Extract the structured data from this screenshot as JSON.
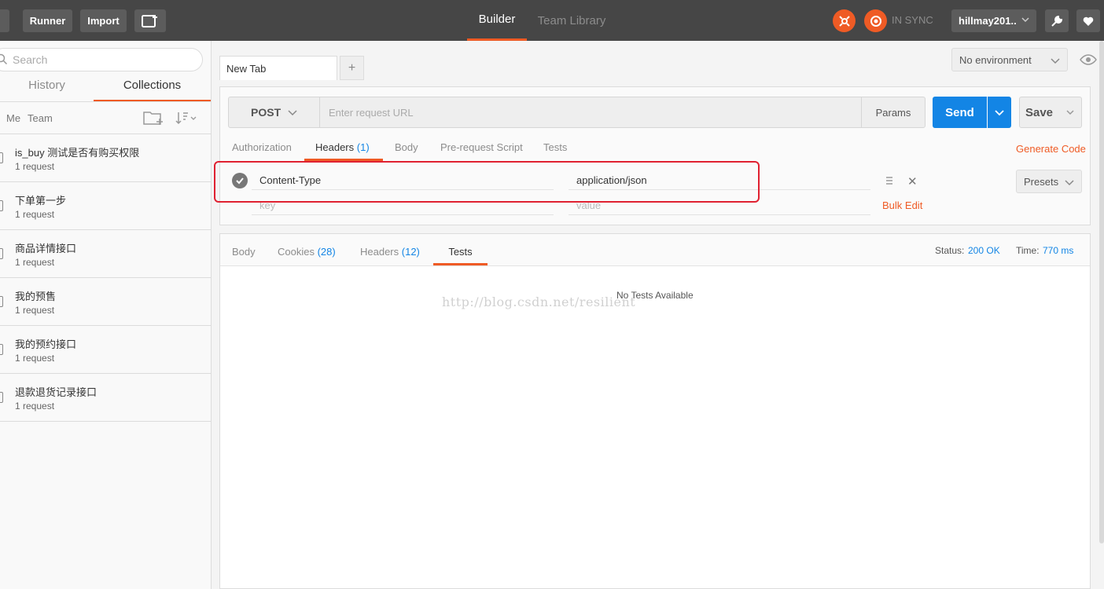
{
  "topbar": {
    "runner_label": "Runner",
    "import_label": "Import",
    "nav": {
      "builder": "Builder",
      "team_library": "Team Library"
    },
    "sync_status": "IN SYNC",
    "user": "hillmay201..",
    "accent": "#ef5b25"
  },
  "sidebar": {
    "search_placeholder": "Search",
    "tabs": {
      "history": "History",
      "collections": "Collections"
    },
    "filters": {
      "me": "Me",
      "team": "Team"
    },
    "collections": [
      {
        "name": "is_buy 测试是否有购买权限",
        "count": "1 request"
      },
      {
        "name": "下单第一步",
        "count": "1 request"
      },
      {
        "name": "商品详情接口",
        "count": "1 request"
      },
      {
        "name": "我的预售",
        "count": "1 request"
      },
      {
        "name": "我的预约接口",
        "count": "1 request"
      },
      {
        "name": "退款退货记录接口",
        "count": "1 request"
      }
    ]
  },
  "main": {
    "tab_label": "New Tab",
    "add_tab": "+",
    "environment": "No environment",
    "request": {
      "method": "POST",
      "url_placeholder": "Enter request URL",
      "params_label": "Params",
      "send_label": "Send",
      "save_label": "Save"
    },
    "request_tabs": {
      "authorization": "Authorization",
      "headers": "Headers",
      "headers_count": "(1)",
      "body": "Body",
      "prerequest": "Pre-request Script",
      "tests": "Tests"
    },
    "generate_code": "Generate Code",
    "headers": {
      "rows": [
        {
          "key": "Content-Type",
          "value": "application/json"
        }
      ],
      "key_placeholder": "key",
      "value_placeholder": "value",
      "bulk_edit": "Bulk Edit",
      "presets": "Presets"
    },
    "response": {
      "tabs": {
        "body": "Body",
        "cookies": "Cookies",
        "cookies_count": "(28)",
        "headers": "Headers",
        "headers_count": "(12)",
        "tests": "Tests"
      },
      "status_label": "Status:",
      "status_value": "200 OK",
      "time_label": "Time:",
      "time_value": "770 ms",
      "empty_message": "No Tests Available",
      "watermark": "http://blog.csdn.net/resilient"
    }
  }
}
